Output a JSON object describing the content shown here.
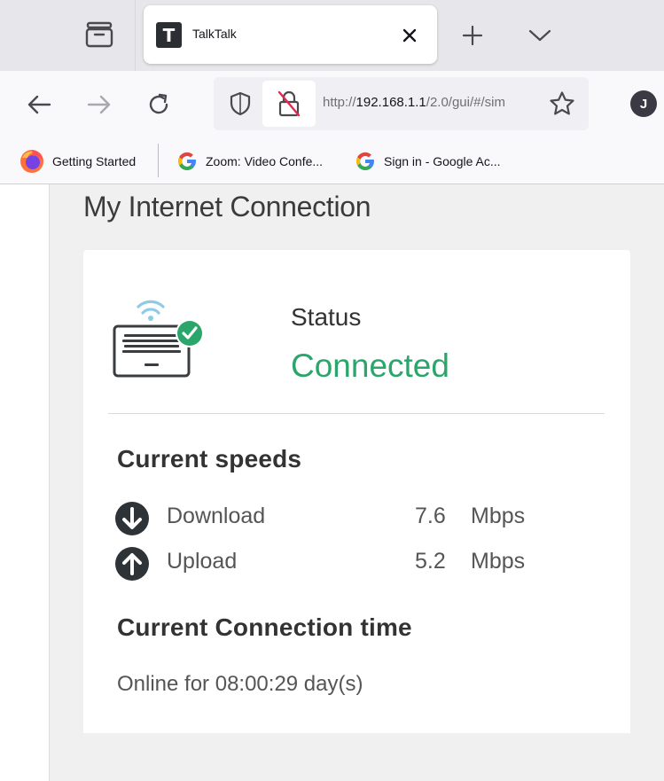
{
  "browser": {
    "tab": {
      "favicon_letter": "T",
      "title": "TalkTalk"
    },
    "url": {
      "scheme": "http://",
      "host": "192.168.1.1",
      "path": "/2.0/gui/#/sim"
    },
    "account_initial": "J",
    "bookmarks": [
      {
        "label": "Getting Started",
        "icon": "firefox-icon"
      },
      {
        "label": "Zoom: Video Confe...",
        "icon": "google-icon"
      },
      {
        "label": "Sign in - Google Ac...",
        "icon": "google-icon"
      }
    ]
  },
  "page": {
    "title": "My Internet Connection",
    "status": {
      "label": "Status",
      "value": "Connected",
      "color": "#2aa66b"
    },
    "speeds": {
      "heading": "Current speeds",
      "download": {
        "label": "Download",
        "value": "7.6",
        "unit": "Mbps"
      },
      "upload": {
        "label": "Upload",
        "value": "5.2",
        "unit": "Mbps"
      }
    },
    "connection_time": {
      "heading": "Current Connection time",
      "text": "Online for 08:00:29 day(s)"
    }
  }
}
